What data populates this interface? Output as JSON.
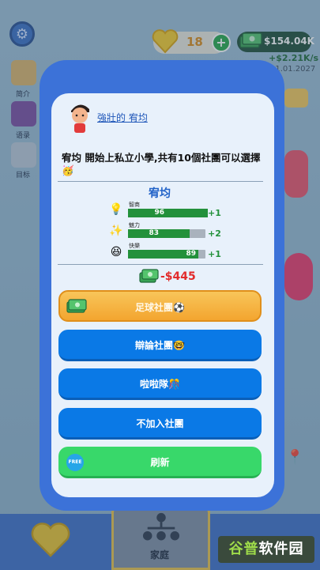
{
  "header": {
    "hearts": "18",
    "money": "$154.04K",
    "money_rate": "+$2.21K/s",
    "date": "21.01.2027"
  },
  "sidebar": {
    "items": [
      {
        "label": "简介"
      },
      {
        "label": "语录"
      },
      {
        "label": "目标"
      }
    ]
  },
  "modal": {
    "person_name": "強壯的 宥均",
    "message": "宥均 開始上私立小學,共有10個社團可以選擇 🥳",
    "stats_title": "宥均",
    "stats": [
      {
        "label": "智商",
        "value": "96",
        "fraction": 0.96,
        "delta": "+1",
        "icon": "lightbulb-icon",
        "glyph": "💡"
      },
      {
        "label": "魅力",
        "value": "83",
        "fraction": 0.83,
        "delta": "+2",
        "icon": "charm-icon",
        "glyph": "✨"
      },
      {
        "label": "快樂",
        "value": "89",
        "fraction": 0.89,
        "delta": "+1",
        "icon": "happy-face-icon",
        "glyph": "😆"
      }
    ],
    "cost": "-$445",
    "buttons": [
      {
        "label": "足球社團⚽"
      },
      {
        "label": "辯論社團🤓"
      },
      {
        "label": "啦啦隊🎊"
      },
      {
        "label": "不加入社團"
      },
      {
        "label": "刷新"
      }
    ],
    "free_badge": "FREE"
  },
  "bottom_nav": {
    "family_label": "家庭"
  },
  "watermark": {
    "left": "谷普",
    "right": "软件园"
  },
  "colors": {
    "modal_border": "#3c72d8",
    "accent_blue": "#0a79e6",
    "accent_green": "#38d86a",
    "accent_orange": "#f3a52f",
    "cost_red": "#e22b2b"
  }
}
